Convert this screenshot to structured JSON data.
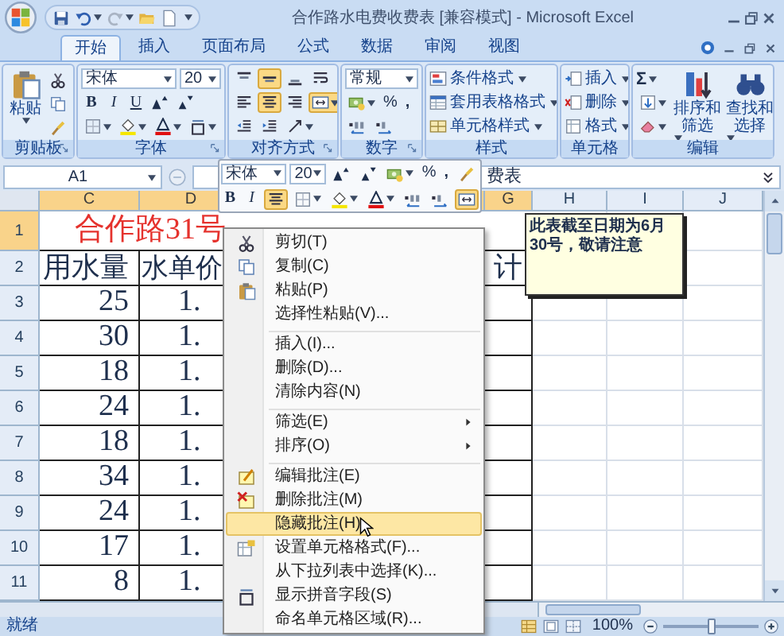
{
  "window": {
    "title": "合作路水电费收费表 [兼容模式] - Microsoft Excel"
  },
  "tabs": [
    {
      "label": "开始",
      "selected": true
    },
    {
      "label": "插入",
      "selected": false
    },
    {
      "label": "页面布局",
      "selected": false
    },
    {
      "label": "公式",
      "selected": false
    },
    {
      "label": "数据",
      "selected": false
    },
    {
      "label": "审阅",
      "selected": false
    },
    {
      "label": "视图",
      "selected": false
    }
  ],
  "ribbon": {
    "clipboard": {
      "label": "剪贴板",
      "paste": "粘贴"
    },
    "font": {
      "label": "字体",
      "font_name": "宋体",
      "font_size": "20",
      "style_buttons": [
        "B",
        "I",
        "U"
      ]
    },
    "alignment": {
      "label": "对齐方式"
    },
    "number": {
      "label": "数字",
      "format": "常规",
      "percent": "%",
      "comma": ","
    },
    "styles": {
      "label": "样式",
      "items": [
        "条件格式",
        "套用表格格式",
        "单元格样式"
      ]
    },
    "cells": {
      "label": "单元格",
      "items": [
        "插入",
        "删除",
        "格式"
      ]
    },
    "editing": {
      "label": "编辑",
      "sum": "Σ",
      "items": [
        "排序和筛选",
        "查找和选择"
      ]
    }
  },
  "formula_bar": {
    "name_box": "A1",
    "formula": "费表"
  },
  "columns": [
    {
      "label": "C",
      "selected": true
    },
    {
      "label": "D",
      "selected": true
    },
    {
      "label": "G",
      "selected": true
    },
    {
      "label": "H",
      "selected": false
    },
    {
      "label": "I",
      "selected": false
    },
    {
      "label": "J",
      "selected": false
    }
  ],
  "rows": [
    {
      "label": "1",
      "selected": true,
      "kind": "title",
      "title": "合作路31号"
    },
    {
      "label": "2",
      "selected": false,
      "kind": "header",
      "cells": [
        "用水量",
        "水单价",
        "计"
      ]
    },
    {
      "label": "3",
      "selected": false,
      "kind": "data",
      "cells": [
        "25",
        "1."
      ]
    },
    {
      "label": "4",
      "selected": false,
      "kind": "data",
      "cells": [
        "30",
        "1."
      ]
    },
    {
      "label": "5",
      "selected": false,
      "kind": "data",
      "cells": [
        "18",
        "1."
      ]
    },
    {
      "label": "6",
      "selected": false,
      "kind": "data",
      "cells": [
        "24",
        "1."
      ]
    },
    {
      "label": "7",
      "selected": false,
      "kind": "data",
      "cells": [
        "18",
        "1."
      ]
    },
    {
      "label": "8",
      "selected": false,
      "kind": "data",
      "cells": [
        "34",
        "1."
      ]
    },
    {
      "label": "9",
      "selected": false,
      "kind": "data",
      "cells": [
        "24",
        "1."
      ]
    },
    {
      "label": "10",
      "selected": false,
      "kind": "data",
      "cells": [
        "17",
        "1."
      ]
    },
    {
      "label": "11",
      "selected": false,
      "kind": "data",
      "cells": [
        "8",
        "1."
      ]
    }
  ],
  "mini_toolbar": {
    "font_name": "宋体",
    "font_size": "20",
    "percent": "%",
    "comma": ",",
    "style_buttons": [
      "B",
      "I"
    ]
  },
  "context_menu": {
    "items": [
      {
        "kind": "item",
        "label": "剪切(T)",
        "selected": false,
        "submenu": false
      },
      {
        "kind": "item",
        "label": "复制(C)",
        "selected": false,
        "submenu": false
      },
      {
        "kind": "item",
        "label": "粘贴(P)",
        "selected": false,
        "submenu": false
      },
      {
        "kind": "item",
        "label": "选择性粘贴(V)...",
        "selected": false,
        "submenu": false
      },
      {
        "kind": "separator"
      },
      {
        "kind": "item",
        "label": "插入(I)...",
        "selected": false,
        "submenu": false
      },
      {
        "kind": "item",
        "label": "删除(D)...",
        "selected": false,
        "submenu": false
      },
      {
        "kind": "item",
        "label": "清除内容(N)",
        "selected": false,
        "submenu": false
      },
      {
        "kind": "separator"
      },
      {
        "kind": "item",
        "label": "筛选(E)",
        "selected": false,
        "submenu": true
      },
      {
        "kind": "item",
        "label": "排序(O)",
        "selected": false,
        "submenu": true
      },
      {
        "kind": "separator"
      },
      {
        "kind": "item",
        "label": "编辑批注(E)",
        "selected": false,
        "submenu": false
      },
      {
        "kind": "item",
        "label": "删除批注(M)",
        "selected": false,
        "submenu": false
      },
      {
        "kind": "item",
        "label": "隐藏批注(H)",
        "selected": true,
        "submenu": false
      },
      {
        "kind": "item",
        "label": "设置单元格格式(F)...",
        "selected": false,
        "submenu": false
      },
      {
        "kind": "item",
        "label": "从下拉列表中选择(K)...",
        "selected": false,
        "submenu": false
      },
      {
        "kind": "item",
        "label": "显示拼音字段(S)",
        "selected": false,
        "submenu": false
      },
      {
        "kind": "item",
        "label": "命名单元格区域(R)...",
        "selected": false,
        "submenu": false
      }
    ]
  },
  "comment": {
    "text": "此表截至日期为6月30号，敬请注意"
  },
  "status_bar": {
    "status": "就绪",
    "zoom": "100%",
    "zoom_slider": {
      "level": 0.5
    }
  }
}
